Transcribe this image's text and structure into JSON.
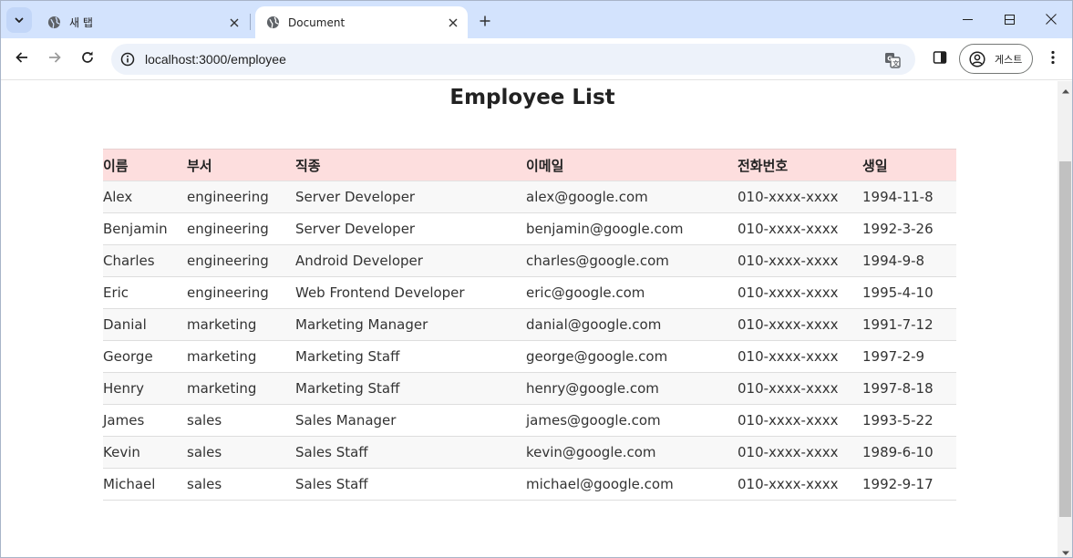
{
  "browser": {
    "tabs": [
      {
        "title": "새 탭",
        "favicon": "globe-icon",
        "active": false
      },
      {
        "title": "Document",
        "favicon": "globe-icon",
        "active": true
      }
    ],
    "url": "localhost:3000/employee",
    "profile_label": "게스트",
    "icons": {
      "tab_search": "chevron-down-icon",
      "tab_close": "close-icon",
      "new_tab": "plus-icon",
      "back": "arrow-left-icon",
      "forward": "arrow-right-icon",
      "reload": "reload-icon",
      "site_info": "info-icon",
      "translate": "translate-icon",
      "side_panel": "side-panel-icon",
      "profile": "person-icon",
      "menu": "kebab-menu-icon"
    }
  },
  "page": {
    "title": "Employee List",
    "table": {
      "headers": [
        "이름",
        "부서",
        "직종",
        "이메일",
        "전화번호",
        "생일"
      ],
      "rows": [
        [
          "Alex",
          "engineering",
          "Server Developer",
          "alex@google.com",
          "010-xxxx-xxxx",
          "1994-11-8"
        ],
        [
          "Benjamin",
          "engineering",
          "Server Developer",
          "benjamin@google.com",
          "010-xxxx-xxxx",
          "1992-3-26"
        ],
        [
          "Charles",
          "engineering",
          "Android Developer",
          "charles@google.com",
          "010-xxxx-xxxx",
          "1994-9-8"
        ],
        [
          "Eric",
          "engineering",
          "Web Frontend Developer",
          "eric@google.com",
          "010-xxxx-xxxx",
          "1995-4-10"
        ],
        [
          "Danial",
          "marketing",
          "Marketing Manager",
          "danial@google.com",
          "010-xxxx-xxxx",
          "1991-7-12"
        ],
        [
          "George",
          "marketing",
          "Marketing Staff",
          "george@google.com",
          "010-xxxx-xxxx",
          "1997-2-9"
        ],
        [
          "Henry",
          "marketing",
          "Marketing Staff",
          "henry@google.com",
          "010-xxxx-xxxx",
          "1997-8-18"
        ],
        [
          "James",
          "sales",
          "Sales Manager",
          "james@google.com",
          "010-xxxx-xxxx",
          "1993-5-22"
        ],
        [
          "Kevin",
          "sales",
          "Sales Staff",
          "kevin@google.com",
          "010-xxxx-xxxx",
          "1989-6-10"
        ],
        [
          "Michael",
          "sales",
          "Sales Staff",
          "michael@google.com",
          "010-xxxx-xxxx",
          "1992-9-17"
        ]
      ]
    }
  },
  "colors": {
    "tabstrip_bg": "#d3e3fd",
    "omnibox_bg": "#edf2fa",
    "header_row_bg": "#fddede",
    "odd_row_bg": "#f8f8f8"
  }
}
